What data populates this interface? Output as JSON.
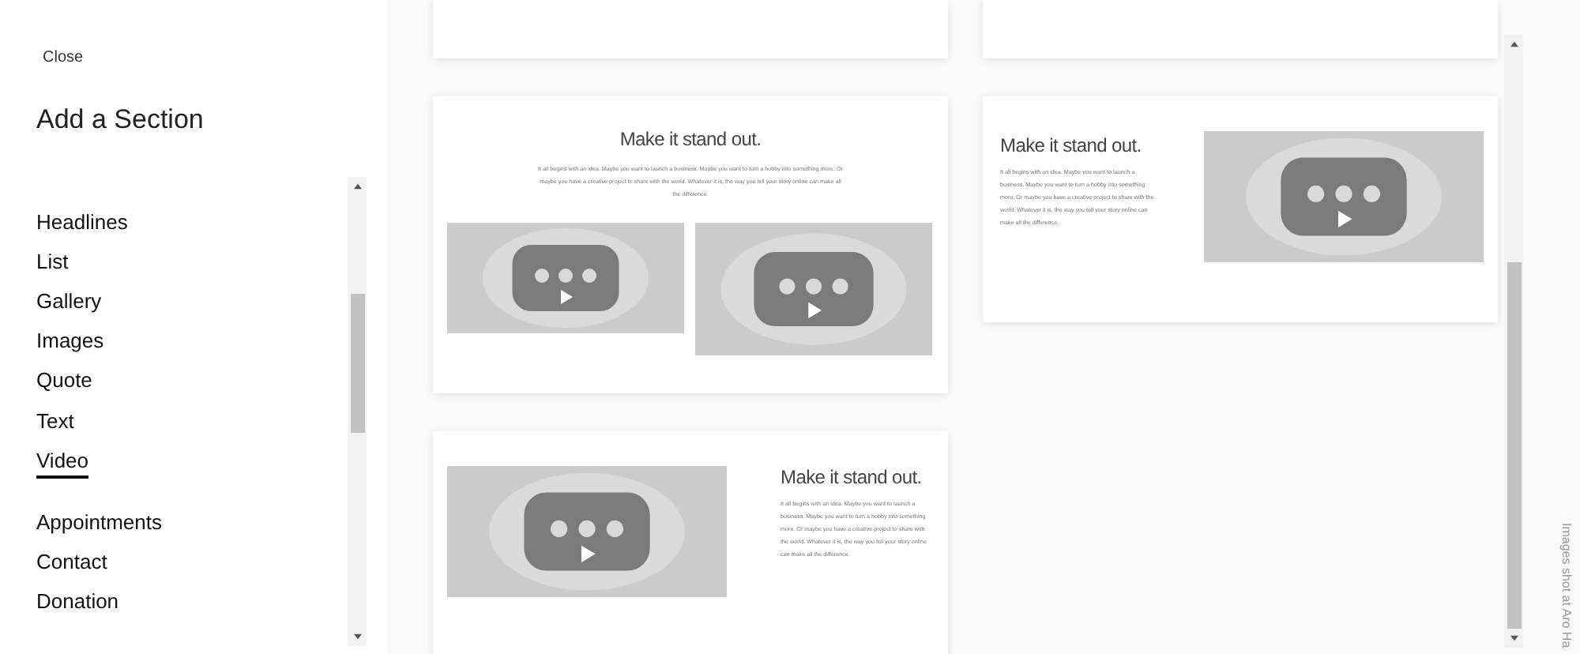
{
  "sidebar": {
    "close": "Close",
    "title": "Add a Section",
    "groups": [
      [
        {
          "label": "Headlines",
          "selected": false
        },
        {
          "label": "List",
          "selected": false
        },
        {
          "label": "Gallery",
          "selected": false
        },
        {
          "label": "Images",
          "selected": false
        },
        {
          "label": "Quote",
          "selected": false
        },
        {
          "label": "Text",
          "selected": false
        },
        {
          "label": "Video",
          "selected": true
        }
      ],
      [
        {
          "label": "Appointments",
          "selected": false
        },
        {
          "label": "Contact",
          "selected": false
        },
        {
          "label": "Donation",
          "selected": false
        }
      ]
    ]
  },
  "columns": [
    [
      {
        "kind": "cut"
      },
      {
        "kind": "stacked",
        "title": "Make it stand out.",
        "text": "It all begins with an idea. Maybe you want to launch a business. Maybe you want to turn a hobby into something more. Or maybe you have a creative project to share with the world. Whatever it is, the way you tell your story online can make all the difference."
      },
      {
        "kind": "video-left",
        "title": "Make it stand out.",
        "text": "It all begins with an idea. Maybe you want to launch a business. Maybe you want to turn a hobby into something more. Or maybe you have a creative project to share with the world. Whatever it is, the way you tell your story online can make all the difference."
      }
    ],
    [
      {
        "kind": "cut"
      },
      {
        "kind": "video-right",
        "title": "Make it stand out.",
        "text": "It all begins with an idea. Maybe you want to launch a business. Maybe you want to turn a hobby into something more. Or maybe you have a creative project to share with the world. Whatever it is, the way you tell your story online can make all the difference."
      }
    ]
  ],
  "credit": "Images shot at Aro Ha"
}
